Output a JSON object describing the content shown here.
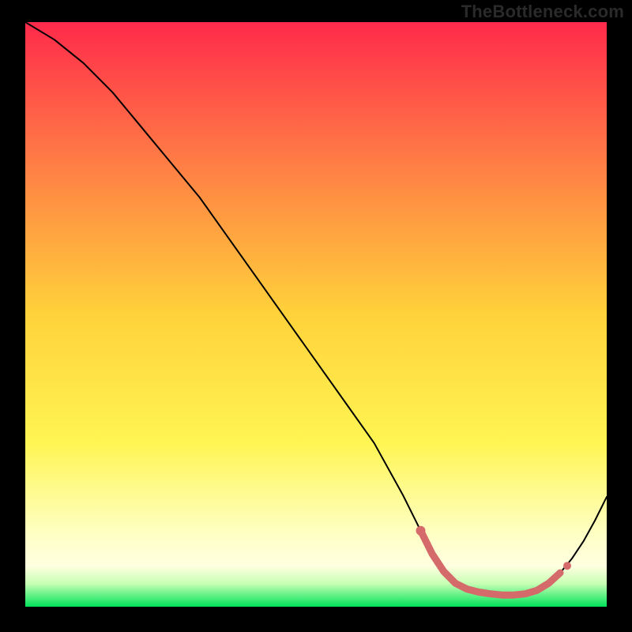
{
  "watermark": "TheBottleneck.com",
  "colors": {
    "background": "#000000",
    "gradient_top": "#ff2a4b",
    "gradient_mid_upper": "#ff7d45",
    "gradient_mid": "#ffd23a",
    "gradient_mid_lower": "#fff553",
    "gradient_pale": "#ffffe1",
    "gradient_bottom": "#00e35a",
    "curve": "#000000",
    "highlight": "#d46a6a"
  },
  "chart_data": {
    "type": "line",
    "title": "",
    "xlabel": "",
    "ylabel": "",
    "xlim": [
      0,
      100
    ],
    "ylim": [
      0,
      100
    ],
    "grid": false,
    "legend": false,
    "series": [
      {
        "name": "bottleneck-curve",
        "x": [
          0,
          5,
          10,
          15,
          20,
          25,
          30,
          35,
          40,
          45,
          50,
          55,
          60,
          65,
          68,
          70,
          72,
          74,
          76,
          78,
          80,
          82,
          84,
          86,
          88,
          90,
          92,
          94,
          96,
          98,
          100
        ],
        "y": [
          100,
          97,
          93,
          88,
          82,
          76,
          70,
          63,
          56,
          49,
          42,
          35,
          28,
          19,
          13,
          9,
          6,
          4,
          3,
          2.5,
          2.2,
          2.0,
          2.0,
          2.2,
          2.8,
          4.0,
          5.8,
          8.2,
          11.2,
          14.8,
          18.8
        ]
      }
    ],
    "highlight_region": {
      "name": "optimal-zone",
      "x": [
        68,
        70,
        72,
        74,
        76,
        78,
        80,
        82,
        84,
        86,
        88,
        90,
        92
      ],
      "y": [
        13,
        9,
        6,
        4,
        3,
        2.5,
        2.2,
        2.0,
        2.0,
        2.2,
        2.8,
        4.0,
        5.8
      ]
    }
  }
}
